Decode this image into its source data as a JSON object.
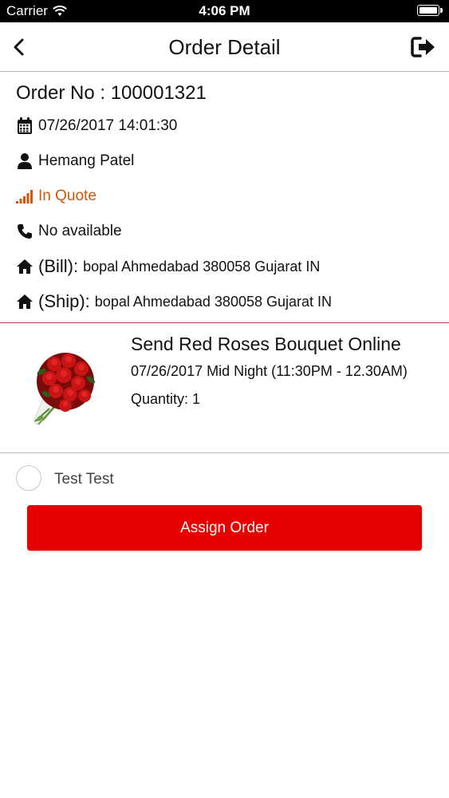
{
  "status_bar": {
    "carrier": "Carrier",
    "time": "4:06 PM"
  },
  "nav": {
    "title": "Order Detail",
    "back_icon": "chevron-left-icon",
    "logout_icon": "sign-out-icon"
  },
  "order": {
    "number_label": "Order No : 100001321",
    "datetime": "07/26/2017 14:01:30",
    "customer": "Hemang Patel",
    "status": "In Quote",
    "phone": "No available",
    "bill_label": "(Bill):",
    "bill_address": "bopal Ahmedabad 380058 Gujarat IN",
    "ship_label": "(Ship):",
    "ship_address": "bopal Ahmedabad 380058 Gujarat IN"
  },
  "product": {
    "name": "Send Red Roses Bouquet Online",
    "delivery": "07/26/2017 Mid Night (11:30PM - 12.30AM)",
    "quantity": "Quantity: 1",
    "image_icon": "rose-bouquet-image"
  },
  "assignee": {
    "name": "Test Test",
    "selected": false
  },
  "actions": {
    "assign_label": "Assign Order"
  },
  "colors": {
    "accent_red": "#e60000",
    "status_orange": "#d4560a",
    "divider_red": "#c83535"
  }
}
